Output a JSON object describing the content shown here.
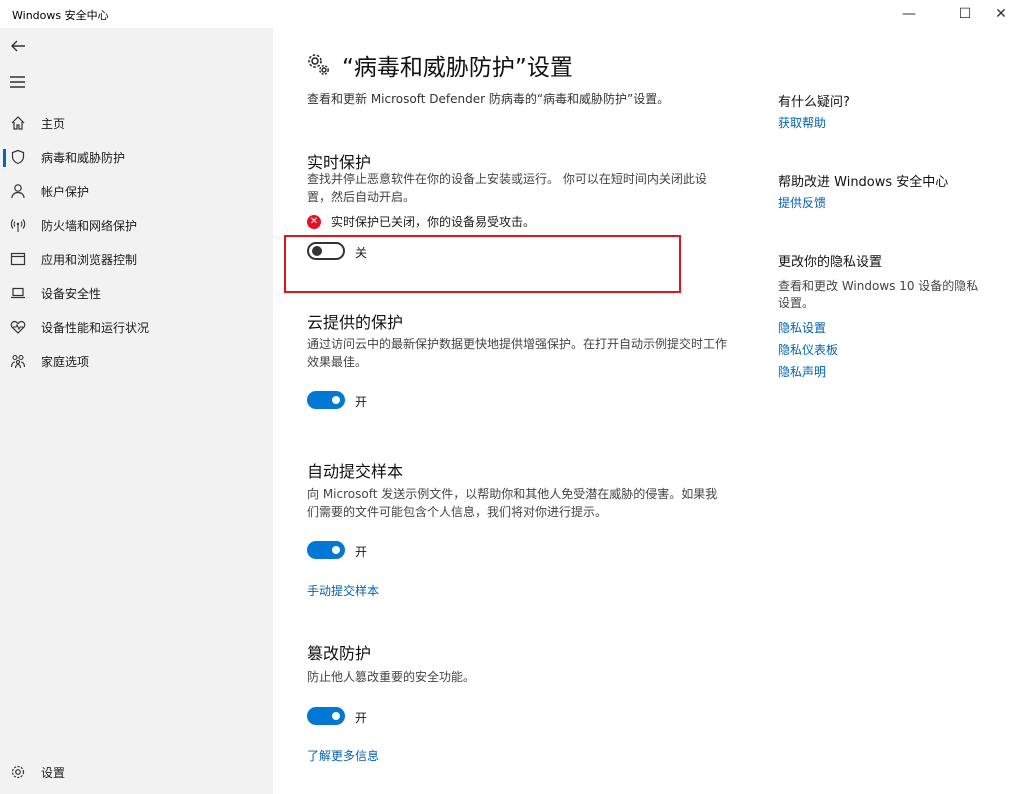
{
  "window": {
    "title": "Windows 安全中心",
    "minimize": "—",
    "maximize": "☐",
    "close": "✕"
  },
  "sidebar": {
    "items": [
      {
        "label": "主页",
        "icon": "home-icon"
      },
      {
        "label": "病毒和威胁防护",
        "icon": "shield-icon"
      },
      {
        "label": "帐户保护",
        "icon": "person-icon"
      },
      {
        "label": "防火墙和网络保护",
        "icon": "wireless-icon"
      },
      {
        "label": "应用和浏览器控制",
        "icon": "app-window-icon"
      },
      {
        "label": "设备安全性",
        "icon": "laptop-icon"
      },
      {
        "label": "设备性能和运行状况",
        "icon": "heart-icon"
      },
      {
        "label": "家庭选项",
        "icon": "family-icon"
      }
    ],
    "settings_label": "设置"
  },
  "main": {
    "title": "“病毒和威胁防护”设置",
    "description": "查看和更新 Microsoft Defender 防病毒的“病毒和威胁防护”设置。",
    "realtime": {
      "title": "实时保护",
      "desc": "查找并停止恶意软件在你的设备上安装或运行。 你可以在短时间内关闭此设置，然后自动开启。",
      "warning": "实时保护已关闭，你的设备易受攻击。",
      "state_label": "关",
      "state": "off"
    },
    "cloud": {
      "title": "云提供的保护",
      "desc": "通过访问云中的最新保护数据更快地提供增强保护。在打开自动示例提交时工作效果最佳。",
      "state_label": "开",
      "state": "on"
    },
    "sample": {
      "title": "自动提交样本",
      "desc": "向 Microsoft 发送示例文件，以帮助你和其他人免受潜在威胁的侵害。如果我们需要的文件可能包含个人信息，我们将对你进行提示。",
      "state_label": "开",
      "state": "on",
      "link": "手动提交样本"
    },
    "tamper": {
      "title": "篡改防护",
      "desc": "防止他人篡改重要的安全功能。",
      "state_label": "开",
      "state": "on",
      "link": "了解更多信息"
    }
  },
  "right": {
    "q_title": "有什么疑问?",
    "q_link": "获取帮助",
    "improve_title": "帮助改进 Windows 安全中心",
    "improve_link": "提供反馈",
    "privacy_title": "更改你的隐私设置",
    "privacy_desc": "查看和更改 Windows 10 设备的隐私设置。",
    "privacy_links": [
      "隐私设置",
      "隐私仪表板",
      "隐私声明"
    ]
  },
  "colors": {
    "accent": "#0078d4",
    "link": "#0062b0",
    "highlight_border": "#e0161b",
    "error": "#e81123"
  }
}
